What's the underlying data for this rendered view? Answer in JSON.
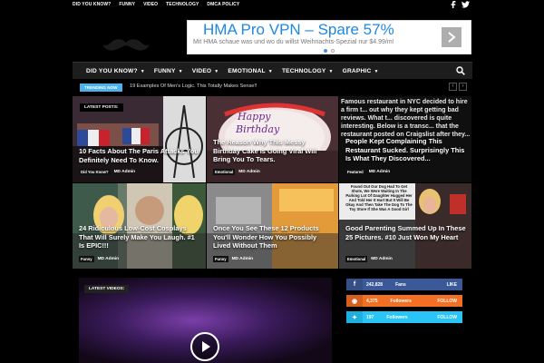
{
  "topbar": {
    "links": [
      "DID YOU KNOW?",
      "FUNNY",
      "VIDEO",
      "TECHNOLOGY",
      "DMCA POLICY"
    ],
    "social_icons": [
      "facebook-icon",
      "twitter-icon"
    ]
  },
  "ad": {
    "title": "HMA Pro VPN – Spare 57%",
    "description": "Mit HMA schaue was und wo du willst Weihnachts-Spezial nur $4.99/m!"
  },
  "nav": {
    "items": [
      "DID YOU KNOW?",
      "FUNNY",
      "VIDEO",
      "EMOTIONAL",
      "TECHNOLOGY",
      "GRAPHIC"
    ]
  },
  "trending": {
    "label": "TRENDING NOW",
    "headline": "19 Examples Of Men's Logic. This Totally Makes Sense!!"
  },
  "grid": {
    "badge": "LATEST POSTS:",
    "tiles": [
      {
        "title": "10 Facts About The Paris Attacks You Definitely Need To Know.",
        "category": "Did You Know?",
        "author": "MD Admin"
      },
      {
        "title": "The Reason Why This Messy Birthday Cake Is Going Viral Will Bring You To Tears.",
        "category": "Emotional",
        "author": "MD Admin",
        "overlay": "Happy Birthday"
      },
      {
        "title": "People Kept Complaining This Restaurant Sucked. Surprisingly This Is What They Discovered...",
        "category": "Featured",
        "author": "MD Admin",
        "overlay": "Famous restaurant in NYC decided to hire a firm t... out why they kept getting bad reviews. What t... discovered is quite interesting. Below is a transc... that the restaurant posted on Craigslist after they... discovered what it was..."
      },
      {
        "title": "24 Ridiculous Low-Cost Cosplays That Will Surely Make You Laugh. #1 Is EPIC!!!",
        "category": "Funny",
        "author": "MD Admin"
      },
      {
        "title": "Once You See These 12 Products You'll Wonder How You Possibly Lived Without Them",
        "category": "Funny",
        "author": "MD Admin"
      },
      {
        "title": "Good Parenting Summed Up In These 25 Pictures. #10 Just Won My Heart",
        "category": "Emotional",
        "author": "MD Admin",
        "overlay": "Found Out Our Dog Had To Get Shots, We Were Waiting In The Parking Lot Of Daughter Hugged Her And Told Her It Hurt But It Will Be Okay And Then Take The Dog To The Toy Store If She Was A Good Girl"
      }
    ]
  },
  "video": {
    "label": "LATEST VIDEOS:"
  },
  "social": [
    {
      "network": "facebook",
      "icon": "facebook-icon",
      "count": "242,828",
      "label": "Fans",
      "action": "LIKE",
      "color": "#3b5998",
      "dark": "#344e86"
    },
    {
      "network": "rss",
      "icon": "rss-icon",
      "count": "4,375",
      "label": "Followers",
      "action": "FOLLOW",
      "color": "#f36f24",
      "dark": "#d45f1e"
    },
    {
      "network": "twitter",
      "icon": "twitter-icon",
      "count": "197",
      "label": "Followers",
      "action": "FOLLOW",
      "color": "#29c5f6",
      "dark": "#1db0de"
    }
  ]
}
